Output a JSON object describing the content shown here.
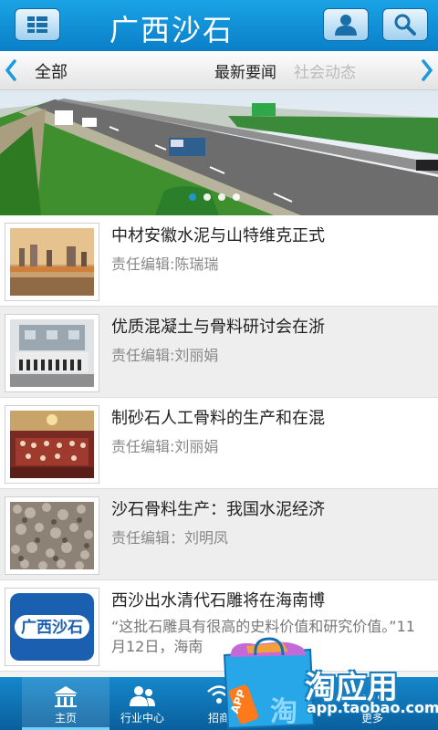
{
  "header": {
    "title": "广西沙石",
    "menu_icon": "grid-menu-icon",
    "user_icon": "user-icon",
    "search_icon": "search-icon"
  },
  "categories": {
    "all": "全部",
    "tabs": [
      "最新要闻",
      "社会动态"
    ],
    "active_tab": "最新要闻"
  },
  "banner": {
    "slides": 4,
    "active_slide": 1
  },
  "articles": [
    {
      "title": "中材安徽水泥与山特维克正式",
      "editor": "责任编辑:陈瑞瑞"
    },
    {
      "title": "优质混凝土与骨料研讨会在浙",
      "editor": "责任编辑:刘丽娟"
    },
    {
      "title": "制砂石人工骨料的生产和在混",
      "editor": "责任编辑:刘丽娟"
    },
    {
      "title": "沙石骨料生产：我国水泥经济",
      "editor": "责任编辑：刘明凤"
    },
    {
      "title": "西沙出水清代石雕将在海南博",
      "desc": "“这批石雕具有很高的史料价值和研究价值。”11月12日，海南",
      "logo_text": "广西沙石"
    }
  ],
  "bottom_nav": [
    {
      "label": "主页",
      "icon": "home-icon",
      "active": true
    },
    {
      "label": "行业中心",
      "icon": "people-icon",
      "active": false
    },
    {
      "label": "招商",
      "icon": "signal-icon",
      "active": false
    },
    {
      "label": "",
      "icon": "message-icon",
      "active": false
    },
    {
      "label": "更多",
      "icon": "more-icon",
      "active": false
    }
  ],
  "watermark": {
    "title": "淘应用",
    "url": "app.taobao.com",
    "badge": "APP",
    "char": "淘"
  },
  "colors": {
    "header_blue": "#0a7fc8",
    "accent": "#1a9be0"
  }
}
